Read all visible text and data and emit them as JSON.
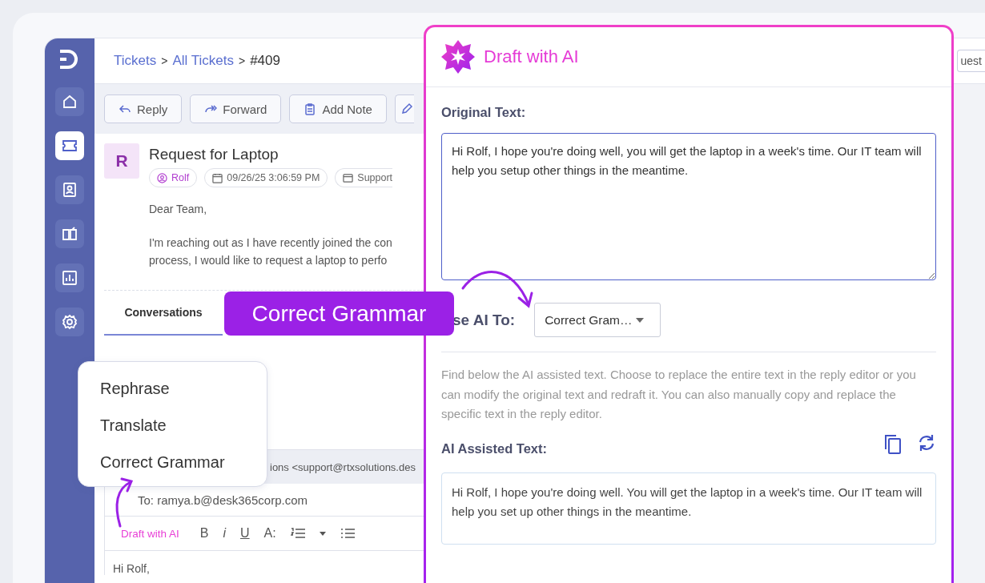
{
  "sidebar": {
    "items": [
      {
        "kind": "home",
        "selected": false
      },
      {
        "kind": "tickets",
        "selected": true
      },
      {
        "kind": "contacts",
        "selected": false
      },
      {
        "kind": "knowledge",
        "selected": false
      },
      {
        "kind": "reports",
        "selected": false
      },
      {
        "kind": "settings",
        "selected": false
      }
    ]
  },
  "breadcrumb": {
    "separator": ">",
    "items": [
      {
        "label": "Tickets",
        "link": true
      },
      {
        "label": "All Tickets",
        "link": true
      },
      {
        "label": "#409",
        "link": false
      }
    ]
  },
  "header_button": "uest",
  "toolbar": [
    {
      "kind": "reply",
      "label": "Reply"
    },
    {
      "kind": "forward",
      "label": "Forward"
    },
    {
      "kind": "note",
      "label": "Add Note"
    },
    {
      "kind": "edit"
    }
  ],
  "ticket": {
    "avatar": "R",
    "title": "Request for Laptop",
    "meta": [
      {
        "kind": "contact",
        "text": "Rolf"
      },
      {
        "kind": "date",
        "text": "09/26/25 3:06:59 PM"
      },
      {
        "kind": "group",
        "text": "Support"
      }
    ],
    "body": [
      "Dear Team,",
      "I'm reaching out as I have recently joined the con",
      "process, I would like to request a laptop to perfo"
    ]
  },
  "tabs": [
    {
      "label": "Conversations",
      "selected": true
    }
  ],
  "compose": {
    "from": "ions <support@rtxsolutions.des",
    "to": "To: ramya.b@desk365corp.com",
    "tools": [
      {
        "kind": "ai",
        "label": "Draft with AI"
      },
      {
        "kind": "bold",
        "label": "B"
      },
      {
        "kind": "italic",
        "label": "i"
      },
      {
        "kind": "underline",
        "label": "U"
      },
      {
        "kind": "size",
        "label": "A:"
      },
      {
        "kind": "numbered-list"
      },
      {
        "kind": "caret"
      },
      {
        "kind": "bullet-list"
      }
    ],
    "body": "Hi Rolf,"
  },
  "ai_menu": [
    {
      "label": "Rephrase"
    },
    {
      "label": "Translate"
    },
    {
      "label": "Correct Grammar"
    }
  ],
  "callout": "Correct Grammar",
  "draft_panel": {
    "title": "Draft with AI",
    "original_label": "Original Text:",
    "original_text": "Hi Rolf, I hope you're doing well, you will get the laptop in a week's time. Our IT team will help you setup other things in the meantime.",
    "action_label": "se AI To:",
    "action_value": "Correct Gram…",
    "help": "Find below the AI assisted text. Choose to replace the entire text in the reply editor or you can modify the original text and redraft it. You can also manually copy and replace the specific text in the reply editor.",
    "result_label": "AI Assisted Text:",
    "result_text": "Hi Rolf, I hope you're doing well. You will get the laptop in a week's time. Our IT team will help you set up other things in the meantime."
  }
}
